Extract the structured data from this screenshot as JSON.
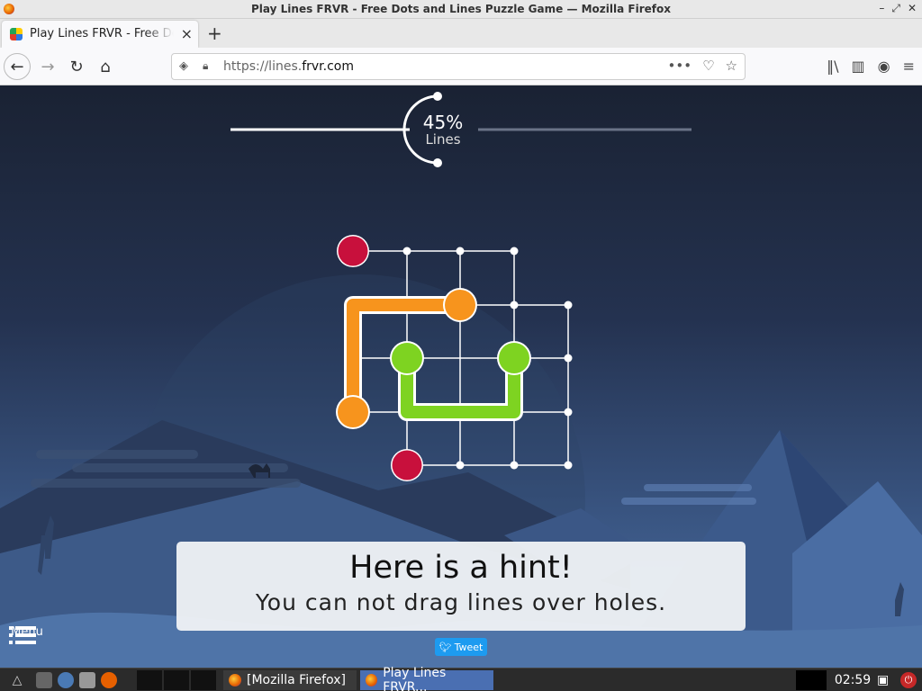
{
  "window": {
    "title": "Play Lines FRVR - Free Dots and Lines Puzzle Game — Mozilla Firefox",
    "minimize": "–",
    "maximize": "⤢",
    "close": "✕"
  },
  "tabs": [
    {
      "title": "Play Lines FRVR - Free Dots and Lines Puzzle Game",
      "close": "×"
    }
  ],
  "new_tab": "+",
  "nav": {
    "back": "←",
    "forward": "→",
    "reload": "↻",
    "home": "⌂",
    "url_prefix": "https://lines.",
    "url_domain": "frvr.com",
    "page_actions": "•••",
    "pocket": "♡",
    "bookmark": "☆",
    "library": "‖\\",
    "sidebar": "▥",
    "account": "◉",
    "menu": "≡"
  },
  "game": {
    "progress_percent": "45%",
    "progress_value": 45,
    "progress_label": "Lines",
    "hint_title": "Here is a hint!",
    "hint_text": "You can not drag lines over holes.",
    "tweet_label": "Tweet",
    "menu_label": "Menu",
    "colors": {
      "orange": "#f7941d",
      "green": "#7ed321",
      "hole": "#c8103c",
      "grid": "#ffffff"
    }
  },
  "taskbar": {
    "tasks": [
      {
        "label": "[Mozilla Firefox]"
      },
      {
        "label": "Play Lines FRVR..."
      }
    ],
    "clock": "02:59",
    "power": "⏻"
  }
}
